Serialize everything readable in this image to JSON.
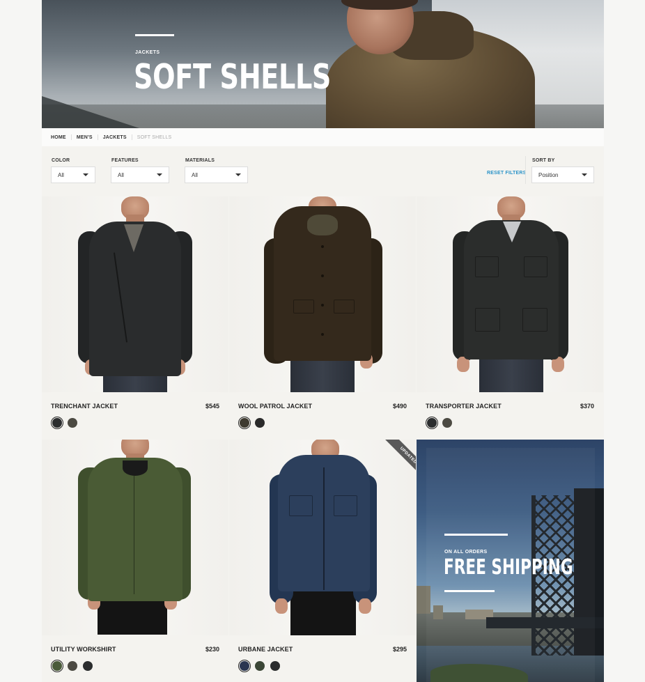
{
  "hero": {
    "category": "JACKETS",
    "title": "SOFT SHELLS"
  },
  "breadcrumb": [
    "HOME",
    "MEN'S",
    "JACKETS",
    "SOFT SHELLS"
  ],
  "filters": {
    "color": {
      "label": "COLOR",
      "value": "All"
    },
    "features": {
      "label": "FEATURES",
      "value": "All"
    },
    "materials": {
      "label": "MATERIALS",
      "value": "All"
    },
    "reset_label": "RESET FILTERS",
    "sort": {
      "label": "SORT BY",
      "value": "Position"
    }
  },
  "products": [
    {
      "name": "TRENCHANT JACKET",
      "price": "$545",
      "badge": "",
      "jacket_color": "#2a2c2d",
      "swatches": [
        "#2b2d2e",
        "#4c4a42"
      ],
      "selected_swatch": 0
    },
    {
      "name": "WOOL PATROL JACKET",
      "price": "$490",
      "badge": "",
      "jacket_color": "#34291c",
      "swatches": [
        "#3e3a30",
        "#2a2a2a"
      ],
      "selected_swatch": 0
    },
    {
      "name": "TRANSPORTER JACKET",
      "price": "$370",
      "badge": "",
      "jacket_color": "#2b2d2c",
      "swatches": [
        "#2b2d2e",
        "#4c4a42"
      ],
      "selected_swatch": 0
    },
    {
      "name": "UTILITY WORKSHIRT",
      "price": "$230",
      "badge": "",
      "jacket_color": "#4a5b35",
      "swatches": [
        "#4a5b3a",
        "#4c4a42",
        "#2b2d2e"
      ],
      "selected_swatch": 0
    },
    {
      "name": "URBANE JACKET",
      "price": "$295",
      "badge": "UPDATED",
      "jacket_color": "#2c3f5c",
      "swatches": [
        "#2a3550",
        "#3b4636",
        "#2b2d2e"
      ],
      "selected_swatch": 0
    }
  ],
  "promo": {
    "subtitle": "ON ALL ORDERS",
    "title": "FREE SHIPPING"
  },
  "icons": {
    "dropdown": "chevron-down-icon"
  }
}
